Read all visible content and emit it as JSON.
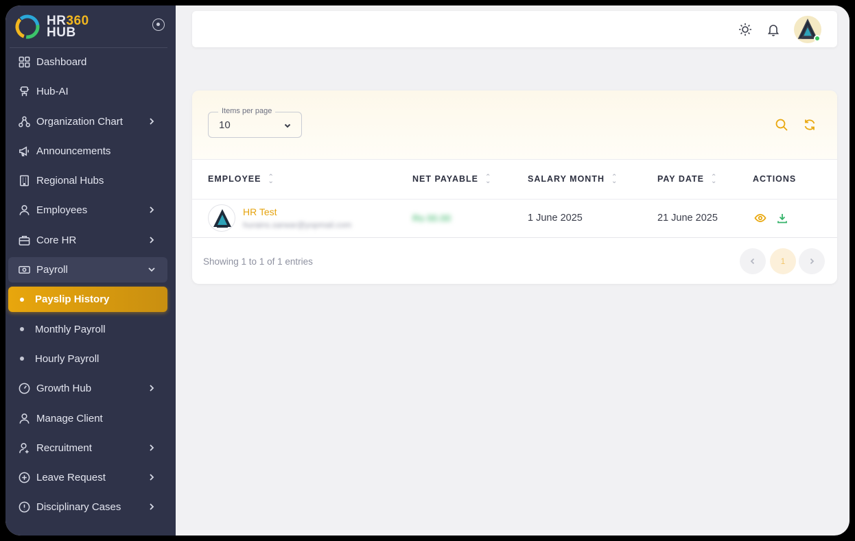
{
  "brand": {
    "line1_a": "HR",
    "line1_b": "360",
    "line2": "HUB"
  },
  "sidebar": {
    "items": [
      {
        "label": "Dashboard",
        "icon": "dashboard-icon"
      },
      {
        "label": "Hub-AI",
        "icon": "robot-icon"
      },
      {
        "label": "Organization Chart",
        "icon": "org-chart-icon",
        "has_children": true
      },
      {
        "label": "Announcements",
        "icon": "megaphone-icon"
      },
      {
        "label": "Regional Hubs",
        "icon": "building-icon"
      },
      {
        "label": "Employees",
        "icon": "user-icon",
        "has_children": true
      },
      {
        "label": "Core HR",
        "icon": "briefcase-icon",
        "has_children": true
      },
      {
        "label": "Payroll",
        "icon": "money-icon",
        "has_children": true,
        "expanded": true
      }
    ],
    "payroll_children": [
      {
        "label": "Payslip History",
        "active": true
      },
      {
        "label": "Monthly Payroll"
      },
      {
        "label": "Hourly Payroll"
      }
    ],
    "items_after": [
      {
        "label": "Growth Hub",
        "icon": "gauge-icon",
        "has_children": true
      },
      {
        "label": "Manage Client",
        "icon": "user-icon"
      },
      {
        "label": "Recruitment",
        "icon": "user-plus-icon",
        "has_children": true
      },
      {
        "label": "Leave Request",
        "icon": "plus-circle-icon",
        "has_children": true
      },
      {
        "label": "Disciplinary Cases",
        "icon": "alert-circle-icon",
        "has_children": true
      }
    ]
  },
  "toolbar": {
    "per_page_label": "Items per page",
    "per_page_value": "10"
  },
  "table": {
    "columns": [
      "EMPLOYEE",
      "NET PAYABLE",
      "SALARY MONTH",
      "PAY DATE",
      "ACTIONS"
    ],
    "rows": [
      {
        "name": "HR Test",
        "email": "hurains.sarwar@yopmail.com",
        "net_payable": "Rs 00.00",
        "salary_month": "1 June 2025",
        "pay_date": "21 June 2025"
      }
    ]
  },
  "footer": {
    "info": "Showing 1 to 1 of 1 entries",
    "current_page": "1"
  },
  "colors": {
    "accent": "#e9a80f",
    "sidebar_bg": "#2f3349",
    "success": "#35b36a"
  }
}
